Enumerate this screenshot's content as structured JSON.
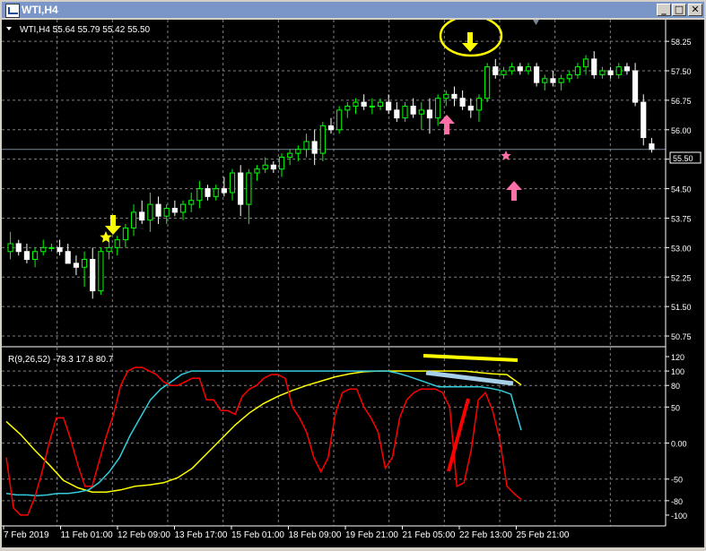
{
  "window": {
    "title": "WTI,H4",
    "btn_minimize": "_",
    "btn_maximize": "□",
    "btn_close": "✕"
  },
  "main": {
    "info": "WTI,H4  55.64 55.79 55.42 55.50",
    "price_ticks": [
      "58.25",
      "57.50",
      "56.75",
      "56.00",
      "55.25",
      "54.50",
      "53.75",
      "53.00",
      "52.25",
      "51.50",
      "50.75"
    ],
    "current_price": "55.50",
    "candles": [
      [
        52.9,
        53.4,
        52.7,
        53.1
      ],
      [
        53.1,
        53.2,
        52.8,
        52.9
      ],
      [
        52.9,
        53.1,
        52.6,
        52.7
      ],
      [
        52.7,
        53.0,
        52.5,
        52.9
      ],
      [
        52.9,
        53.2,
        52.8,
        53.0
      ],
      [
        53.0,
        53.1,
        52.9,
        53.0
      ],
      [
        53.0,
        53.2,
        52.8,
        52.9
      ],
      [
        52.9,
        53.1,
        52.6,
        52.6
      ],
      [
        52.6,
        52.8,
        52.3,
        52.5
      ],
      [
        52.5,
        52.9,
        52.0,
        52.7
      ],
      [
        52.7,
        53.0,
        51.7,
        51.9
      ],
      [
        51.9,
        53.0,
        51.8,
        52.9
      ],
      [
        52.9,
        53.3,
        52.7,
        53.0
      ],
      [
        53.0,
        53.3,
        52.8,
        53.2
      ],
      [
        53.2,
        53.6,
        53.0,
        53.5
      ],
      [
        53.5,
        54.1,
        53.3,
        53.9
      ],
      [
        53.9,
        54.2,
        53.6,
        53.7
      ],
      [
        53.7,
        54.4,
        53.4,
        54.1
      ],
      [
        54.1,
        54.3,
        53.6,
        53.8
      ],
      [
        53.8,
        54.1,
        53.6,
        54.0
      ],
      [
        54.0,
        54.2,
        53.8,
        53.9
      ],
      [
        53.9,
        54.2,
        53.7,
        54.1
      ],
      [
        54.1,
        54.4,
        53.9,
        54.2
      ],
      [
        54.2,
        54.7,
        54.0,
        54.5
      ],
      [
        54.5,
        54.6,
        54.2,
        54.3
      ],
      [
        54.3,
        54.6,
        54.2,
        54.5
      ],
      [
        54.5,
        54.8,
        54.3,
        54.4
      ],
      [
        54.4,
        55.0,
        54.2,
        54.9
      ],
      [
        54.9,
        55.1,
        53.8,
        54.1
      ],
      [
        54.1,
        55.0,
        53.6,
        54.9
      ],
      [
        54.9,
        55.1,
        54.7,
        55.0
      ],
      [
        55.0,
        55.3,
        54.9,
        55.1
      ],
      [
        55.1,
        55.2,
        54.9,
        55.0
      ],
      [
        55.0,
        55.4,
        54.8,
        55.3
      ],
      [
        55.3,
        55.5,
        55.1,
        55.4
      ],
      [
        55.4,
        55.6,
        55.2,
        55.5
      ],
      [
        55.5,
        55.9,
        55.3,
        55.7
      ],
      [
        55.7,
        56.0,
        55.1,
        55.4
      ],
      [
        55.4,
        56.2,
        55.2,
        56.1
      ],
      [
        56.1,
        56.3,
        55.9,
        56.0
      ],
      [
        56.0,
        56.6,
        55.9,
        56.5
      ],
      [
        56.5,
        56.7,
        56.3,
        56.6
      ],
      [
        56.6,
        56.8,
        56.4,
        56.7
      ],
      [
        56.7,
        56.9,
        56.5,
        56.6
      ],
      [
        56.6,
        56.8,
        56.4,
        56.6
      ],
      [
        56.6,
        56.8,
        56.5,
        56.7
      ],
      [
        56.7,
        56.9,
        56.4,
        56.5
      ],
      [
        56.5,
        56.7,
        56.2,
        56.3
      ],
      [
        56.3,
        56.7,
        56.2,
        56.6
      ],
      [
        56.6,
        56.8,
        56.3,
        56.4
      ],
      [
        56.4,
        56.7,
        56.0,
        56.5
      ],
      [
        56.5,
        56.8,
        55.9,
        56.3
      ],
      [
        56.3,
        56.9,
        56.1,
        56.8
      ],
      [
        56.8,
        57.0,
        56.6,
        56.9
      ],
      [
        56.9,
        57.1,
        56.6,
        56.8
      ],
      [
        56.8,
        57.0,
        56.5,
        56.6
      ],
      [
        56.6,
        56.8,
        56.3,
        56.5
      ],
      [
        56.5,
        56.9,
        56.2,
        56.8
      ],
      [
        56.8,
        57.7,
        56.7,
        57.6
      ],
      [
        57.6,
        57.8,
        57.3,
        57.4
      ],
      [
        57.4,
        57.6,
        57.3,
        57.5
      ],
      [
        57.5,
        57.7,
        57.4,
        57.6
      ],
      [
        57.6,
        57.7,
        57.4,
        57.5
      ],
      [
        57.5,
        57.7,
        57.4,
        57.6
      ],
      [
        57.6,
        57.7,
        57.1,
        57.2
      ],
      [
        57.2,
        57.4,
        57.0,
        57.3
      ],
      [
        57.3,
        57.5,
        57.1,
        57.2
      ],
      [
        57.2,
        57.4,
        57.0,
        57.3
      ],
      [
        57.3,
        57.5,
        57.2,
        57.4
      ],
      [
        57.4,
        57.7,
        57.3,
        57.6
      ],
      [
        57.6,
        57.9,
        57.4,
        57.8
      ],
      [
        57.8,
        58.0,
        57.3,
        57.4
      ],
      [
        57.4,
        57.6,
        57.3,
        57.5
      ],
      [
        57.5,
        57.6,
        57.3,
        57.4
      ],
      [
        57.4,
        57.7,
        57.3,
        57.6
      ],
      [
        57.6,
        57.7,
        57.4,
        57.5
      ],
      [
        57.5,
        57.7,
        56.6,
        56.7
      ],
      [
        56.7,
        56.9,
        55.6,
        55.8
      ],
      [
        55.64,
        55.79,
        55.42,
        55.5
      ]
    ]
  },
  "indicator": {
    "info": "R(9,26,52) -78.3 17.8 80.7",
    "ticks": [
      "120",
      "100",
      "80",
      "50",
      "0.00",
      "-50",
      "-80",
      "-100"
    ],
    "red": [
      -20,
      -90,
      -100,
      -100,
      -75,
      -40,
      0,
      35,
      35,
      5,
      -30,
      -60,
      -60,
      -25,
      10,
      40,
      80,
      100,
      105,
      105,
      100,
      95,
      85,
      80,
      80,
      85,
      90,
      90,
      60,
      60,
      45,
      45,
      40,
      65,
      75,
      80,
      90,
      95,
      95,
      90,
      50,
      35,
      15,
      -20,
      -40,
      -20,
      40,
      70,
      75,
      75,
      50,
      35,
      15,
      -35,
      -20,
      35,
      60,
      70,
      75,
      75,
      75,
      70,
      50,
      -60,
      -55,
      -10,
      60,
      70,
      45,
      5,
      -60,
      -70,
      -78.3
    ],
    "cyan": [
      -70,
      -72,
      -72,
      -73,
      -72,
      -70,
      -70,
      -68,
      -65,
      -55,
      -40,
      -20,
      10,
      35,
      60,
      75,
      85,
      95,
      100,
      100,
      100,
      100,
      100,
      100,
      100,
      100,
      100,
      100,
      100,
      100,
      100,
      100,
      100,
      100,
      100,
      100,
      100,
      100,
      97,
      93,
      88,
      83,
      78,
      78,
      78,
      78,
      78,
      76,
      73,
      68,
      17.8
    ],
    "yellow": [
      30,
      12,
      -10,
      -30,
      -52,
      -62,
      -68,
      -68,
      -65,
      -60,
      -58,
      -55,
      -48,
      -35,
      -15,
      5,
      25,
      42,
      55,
      65,
      73,
      80,
      86,
      92,
      96,
      99,
      100,
      100,
      100,
      100,
      100,
      100,
      100,
      98,
      96,
      95,
      80.7
    ]
  },
  "x_labels": [
    "7 Feb 2019",
    "11 Feb 01:00",
    "12 Feb 09:00",
    "13 Feb 17:00",
    "15 Feb 01:00",
    "18 Feb 09:00",
    "19 Feb 21:00",
    "21 Feb 05:00",
    "22 Feb 13:00",
    "25 Feb 21:00"
  ],
  "colors": {
    "bull": "#00ff00",
    "bear": "#ffffff",
    "grid": "#808080",
    "red_line": "#ff0000",
    "cyan_line": "#33ccdd",
    "yellow_line": "#ffff00",
    "arrow_yellow": "#ffff00",
    "arrow_pink": "#ff6fa8",
    "annotation_light": "#a8cfe8"
  }
}
